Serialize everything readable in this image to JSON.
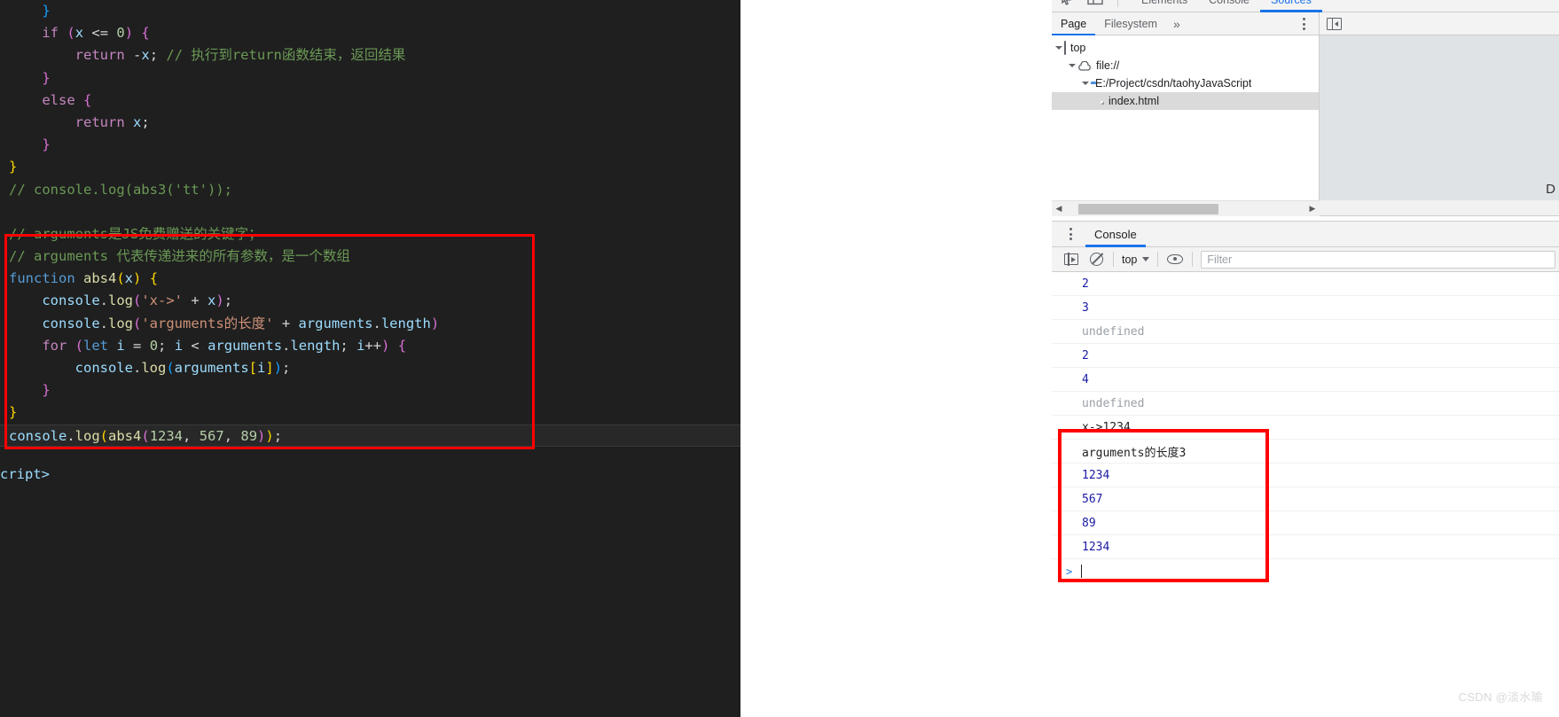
{
  "editor": {
    "lines": [
      {
        "id": "l1",
        "segs": [
          {
            "t": "    ",
            "c": "op"
          },
          {
            "t": "}",
            "c": "p3"
          }
        ],
        "active": false
      },
      {
        "id": "l2",
        "segs": [
          {
            "t": "    ",
            "c": "op"
          },
          {
            "t": "if",
            "c": "kw2"
          },
          {
            "t": " ",
            "c": "op"
          },
          {
            "t": "(",
            "c": "p2"
          },
          {
            "t": "x",
            "c": "var"
          },
          {
            "t": " <= ",
            "c": "op"
          },
          {
            "t": "0",
            "c": "num"
          },
          {
            "t": ")",
            "c": "p2"
          },
          {
            "t": " ",
            "c": "op"
          },
          {
            "t": "{",
            "c": "p2"
          }
        ],
        "active": false
      },
      {
        "id": "l3",
        "segs": [
          {
            "t": "        ",
            "c": "op"
          },
          {
            "t": "return",
            "c": "kw2"
          },
          {
            "t": " ",
            "c": "op"
          },
          {
            "t": "-",
            "c": "op"
          },
          {
            "t": "x",
            "c": "var"
          },
          {
            "t": "; ",
            "c": "op"
          },
          {
            "t": "// 执行到return函数结束，返回结果",
            "c": "cmt"
          }
        ],
        "active": false
      },
      {
        "id": "l4",
        "segs": [
          {
            "t": "    ",
            "c": "op"
          },
          {
            "t": "}",
            "c": "p2"
          }
        ],
        "active": false
      },
      {
        "id": "l5",
        "segs": [
          {
            "t": "    ",
            "c": "op"
          },
          {
            "t": "else",
            "c": "kw2"
          },
          {
            "t": " ",
            "c": "op"
          },
          {
            "t": "{",
            "c": "p2"
          }
        ],
        "active": false
      },
      {
        "id": "l6",
        "segs": [
          {
            "t": "        ",
            "c": "op"
          },
          {
            "t": "return",
            "c": "kw2"
          },
          {
            "t": " ",
            "c": "op"
          },
          {
            "t": "x",
            "c": "var"
          },
          {
            "t": ";",
            "c": "op"
          }
        ],
        "active": false
      },
      {
        "id": "l7",
        "segs": [
          {
            "t": "    ",
            "c": "op"
          },
          {
            "t": "}",
            "c": "p2"
          }
        ],
        "active": false
      },
      {
        "id": "l8",
        "segs": [
          {
            "t": "}",
            "c": "p1"
          }
        ],
        "active": false
      },
      {
        "id": "l9",
        "segs": [
          {
            "t": "// console.log(abs3('tt'));",
            "c": "cmt"
          }
        ],
        "active": false
      },
      {
        "id": "l10",
        "segs": [
          {
            "t": " ",
            "c": "op"
          }
        ],
        "active": false
      },
      {
        "id": "l11",
        "segs": [
          {
            "t": "// arguments是JS免费赠送的关键字；",
            "c": "cmt"
          }
        ],
        "active": false
      },
      {
        "id": "l12",
        "segs": [
          {
            "t": "// arguments 代表传递进来的所有参数，是一个数组",
            "c": "cmt"
          }
        ],
        "active": false
      },
      {
        "id": "l13",
        "segs": [
          {
            "t": "function",
            "c": "kw"
          },
          {
            "t": " ",
            "c": "op"
          },
          {
            "t": "abs4",
            "c": "fn"
          },
          {
            "t": "(",
            "c": "p1"
          },
          {
            "t": "x",
            "c": "var"
          },
          {
            "t": ")",
            "c": "p1"
          },
          {
            "t": " ",
            "c": "op"
          },
          {
            "t": "{",
            "c": "p1"
          }
        ],
        "active": false
      },
      {
        "id": "l14",
        "segs": [
          {
            "t": "    ",
            "c": "op"
          },
          {
            "t": "console",
            "c": "var"
          },
          {
            "t": ".",
            "c": "op"
          },
          {
            "t": "log",
            "c": "fn"
          },
          {
            "t": "(",
            "c": "p2"
          },
          {
            "t": "'x->'",
            "c": "str"
          },
          {
            "t": " + ",
            "c": "op"
          },
          {
            "t": "x",
            "c": "var"
          },
          {
            "t": ")",
            "c": "p2"
          },
          {
            "t": ";",
            "c": "op"
          }
        ],
        "active": false
      },
      {
        "id": "l15",
        "segs": [
          {
            "t": "    ",
            "c": "op"
          },
          {
            "t": "console",
            "c": "var"
          },
          {
            "t": ".",
            "c": "op"
          },
          {
            "t": "log",
            "c": "fn"
          },
          {
            "t": "(",
            "c": "p2"
          },
          {
            "t": "'arguments的长度'",
            "c": "str"
          },
          {
            "t": " + ",
            "c": "op"
          },
          {
            "t": "arguments",
            "c": "var"
          },
          {
            "t": ".",
            "c": "op"
          },
          {
            "t": "length",
            "c": "var"
          },
          {
            "t": ")",
            "c": "p2"
          }
        ],
        "active": false
      },
      {
        "id": "l16",
        "segs": [
          {
            "t": "    ",
            "c": "op"
          },
          {
            "t": "for",
            "c": "kw2"
          },
          {
            "t": " ",
            "c": "op"
          },
          {
            "t": "(",
            "c": "p2"
          },
          {
            "t": "let",
            "c": "kw"
          },
          {
            "t": " ",
            "c": "op"
          },
          {
            "t": "i",
            "c": "var"
          },
          {
            "t": " = ",
            "c": "op"
          },
          {
            "t": "0",
            "c": "num"
          },
          {
            "t": "; ",
            "c": "op"
          },
          {
            "t": "i",
            "c": "var"
          },
          {
            "t": " < ",
            "c": "op"
          },
          {
            "t": "arguments",
            "c": "var"
          },
          {
            "t": ".",
            "c": "op"
          },
          {
            "t": "length",
            "c": "var"
          },
          {
            "t": "; ",
            "c": "op"
          },
          {
            "t": "i",
            "c": "var"
          },
          {
            "t": "++",
            "c": "op"
          },
          {
            "t": ")",
            "c": "p2"
          },
          {
            "t": " ",
            "c": "op"
          },
          {
            "t": "{",
            "c": "p2"
          }
        ],
        "active": false
      },
      {
        "id": "l17",
        "segs": [
          {
            "t": "        ",
            "c": "op"
          },
          {
            "t": "console",
            "c": "var"
          },
          {
            "t": ".",
            "c": "op"
          },
          {
            "t": "log",
            "c": "fn"
          },
          {
            "t": "(",
            "c": "p3"
          },
          {
            "t": "arguments",
            "c": "var"
          },
          {
            "t": "[",
            "c": "p1"
          },
          {
            "t": "i",
            "c": "var"
          },
          {
            "t": "]",
            "c": "p1"
          },
          {
            "t": ")",
            "c": "p3"
          },
          {
            "t": ";",
            "c": "op"
          }
        ],
        "active": false
      },
      {
        "id": "l18",
        "segs": [
          {
            "t": "    ",
            "c": "op"
          },
          {
            "t": "}",
            "c": "p2"
          }
        ],
        "active": false
      },
      {
        "id": "l19",
        "segs": [
          {
            "t": "}",
            "c": "p1"
          }
        ],
        "active": false
      },
      {
        "id": "l20",
        "segs": [
          {
            "t": "console",
            "c": "var"
          },
          {
            "t": ".",
            "c": "op"
          },
          {
            "t": "log",
            "c": "fn"
          },
          {
            "t": "(",
            "c": "p1"
          },
          {
            "t": "abs4",
            "c": "fn"
          },
          {
            "t": "(",
            "c": "p2"
          },
          {
            "t": "1234",
            "c": "num"
          },
          {
            "t": ", ",
            "c": "op"
          },
          {
            "t": "567",
            "c": "num"
          },
          {
            "t": ", ",
            "c": "op"
          },
          {
            "t": "89",
            "c": "num"
          },
          {
            "t": ")",
            "c": "p2"
          },
          {
            "t": ")",
            "c": "p1"
          },
          {
            "t": ";",
            "c": "op"
          }
        ],
        "active": true
      }
    ],
    "trailing_tag": "cript>"
  },
  "devtools": {
    "main_tabs": [
      {
        "label": "Elements",
        "active": false
      },
      {
        "label": "Console",
        "active": false
      },
      {
        "label": "Sources",
        "active": true
      }
    ],
    "navigator": {
      "tabs": [
        {
          "label": "Page",
          "active": true
        },
        {
          "label": "Filesystem",
          "active": false
        }
      ],
      "more_label": "»",
      "tree": [
        {
          "label": "top",
          "depth": 0,
          "icon": "frame-icon",
          "expanded": true,
          "selected": false
        },
        {
          "label": "file://",
          "depth": 1,
          "icon": "cloud-icon",
          "expanded": true,
          "selected": false
        },
        {
          "label": "E:/Project/csdn/taohyJavaScript",
          "depth": 2,
          "icon": "folder-icon",
          "expanded": true,
          "selected": false
        },
        {
          "label": "index.html",
          "depth": 3,
          "icon": "file-icon",
          "expanded": false,
          "selected": true
        }
      ]
    },
    "source_stub": {
      "corner_letter": "D"
    },
    "drawer": {
      "tabs": [
        {
          "label": "Console",
          "active": true
        }
      ],
      "toolbar": {
        "context_label": "top",
        "filter_placeholder": "Filter"
      },
      "logs": [
        {
          "text": "2",
          "kind": "num",
          "boxed": false
        },
        {
          "text": "3",
          "kind": "num",
          "boxed": false
        },
        {
          "text": "undefined",
          "kind": "undef",
          "boxed": false
        },
        {
          "text": "2",
          "kind": "num",
          "boxed": false
        },
        {
          "text": "4",
          "kind": "num",
          "boxed": false
        },
        {
          "text": "undefined",
          "kind": "undef",
          "boxed": false
        },
        {
          "text": "x->1234",
          "kind": "txt",
          "boxed": true
        },
        {
          "text": "arguments的长度3",
          "kind": "txt",
          "boxed": true
        },
        {
          "text": "1234",
          "kind": "num",
          "boxed": true
        },
        {
          "text": "567",
          "kind": "num",
          "boxed": true
        },
        {
          "text": "89",
          "kind": "num",
          "boxed": true
        },
        {
          "text": "1234",
          "kind": "num",
          "boxed": true
        }
      ],
      "prompt_symbol": ">"
    }
  },
  "annotations": {
    "code_highlight_color": "#ff0000",
    "console_highlight_color": "#ff0000"
  },
  "watermark": "CSDN @淡水瑜"
}
